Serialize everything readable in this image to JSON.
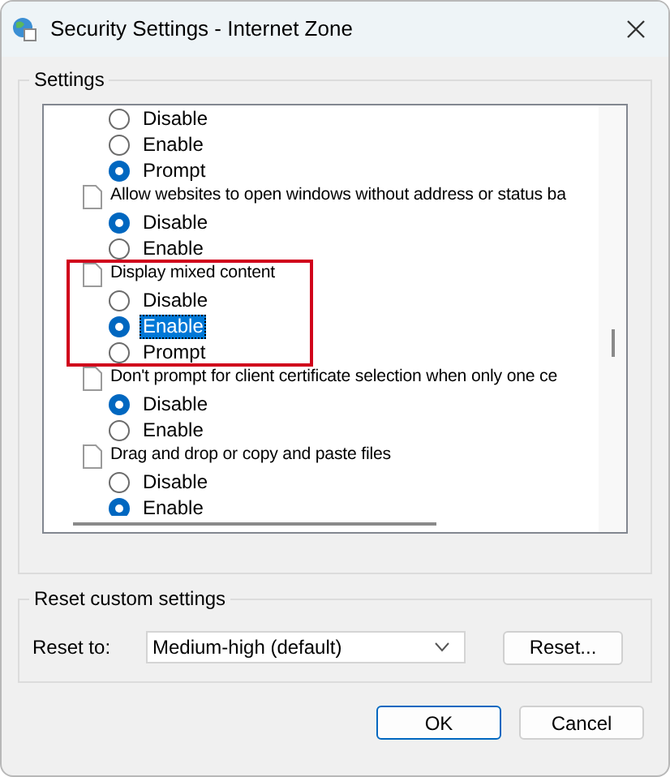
{
  "window": {
    "title": "Security Settings - Internet Zone"
  },
  "settings_group": {
    "label": "Settings"
  },
  "settings": [
    {
      "options": [
        {
          "label": "Disable",
          "selected": false,
          "focused": false
        },
        {
          "label": "Enable",
          "selected": false,
          "focused": false
        },
        {
          "label": "Prompt",
          "selected": true,
          "focused": false
        }
      ],
      "highlighted": false
    },
    {
      "title": "Allow websites to open windows without address or status ba",
      "options": [
        {
          "label": "Disable",
          "selected": true,
          "focused": false
        },
        {
          "label": "Enable",
          "selected": false,
          "focused": false
        }
      ],
      "highlighted": false
    },
    {
      "title": "Display mixed content",
      "options": [
        {
          "label": "Disable",
          "selected": false,
          "focused": false
        },
        {
          "label": "Enable",
          "selected": true,
          "focused": true
        },
        {
          "label": "Prompt",
          "selected": false,
          "focused": false
        }
      ],
      "highlighted": true
    },
    {
      "title": "Don't prompt for client certificate selection when only one ce",
      "options": [
        {
          "label": "Disable",
          "selected": true,
          "focused": false
        },
        {
          "label": "Enable",
          "selected": false,
          "focused": false
        }
      ],
      "highlighted": false
    },
    {
      "title": "Drag and drop or copy and paste files",
      "options": [
        {
          "label": "Disable",
          "selected": false,
          "focused": false
        },
        {
          "label": "Enable",
          "selected": true,
          "focused": false
        }
      ],
      "highlighted": false
    }
  ],
  "reset_group": {
    "label": "Reset custom settings",
    "reset_to_label": "Reset to:",
    "reset_to_value": "Medium-high (default)",
    "reset_button": "Reset..."
  },
  "buttons": [
    "OK",
    "Cancel"
  ]
}
